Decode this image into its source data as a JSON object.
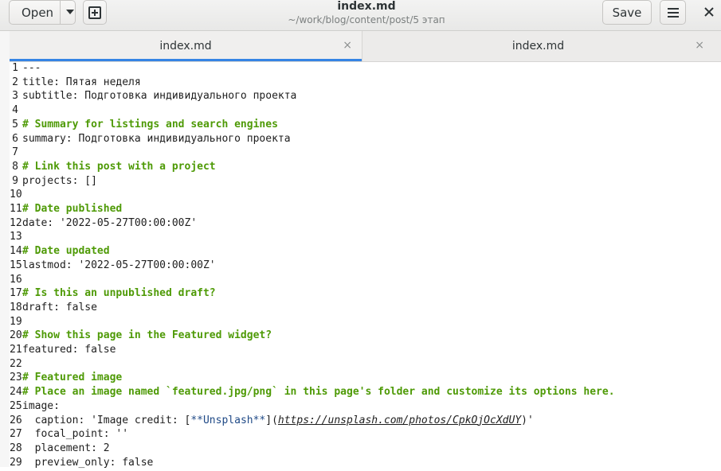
{
  "header": {
    "open_label": "Open",
    "title": "index.md",
    "subtitle": "~/work/blog/content/post/5 этап",
    "save_label": "Save"
  },
  "tabs": [
    {
      "label": "index.md",
      "close": "×"
    },
    {
      "label": "index.md",
      "close": "×"
    }
  ],
  "lines": [
    {
      "n": "1",
      "text": "---"
    },
    {
      "n": "2",
      "text": "title: Пятая неделя"
    },
    {
      "n": "3",
      "text": "subtitle: Подготовка индивидуального проекта"
    },
    {
      "n": "4",
      "text": ""
    },
    {
      "n": "5",
      "text": "# Summary for listings and search engines",
      "comment": true
    },
    {
      "n": "6",
      "text": "summary: Подготовка индивидуального проекта"
    },
    {
      "n": "7",
      "text": ""
    },
    {
      "n": "8",
      "text": "# Link this post with a project",
      "comment": true
    },
    {
      "n": "9",
      "text": "projects: []"
    },
    {
      "n": "10",
      "text": ""
    },
    {
      "n": "11",
      "text": "# Date published",
      "comment": true
    },
    {
      "n": "12",
      "text": "date: '2022-05-27T00:00:00Z'"
    },
    {
      "n": "13",
      "text": ""
    },
    {
      "n": "14",
      "text": "# Date updated",
      "comment": true
    },
    {
      "n": "15",
      "text": "lastmod: '2022-05-27T00:00:00Z'"
    },
    {
      "n": "16",
      "text": ""
    },
    {
      "n": "17",
      "text": "# Is this an unpublished draft?",
      "comment": true
    },
    {
      "n": "18",
      "text": "draft: false"
    },
    {
      "n": "19",
      "text": ""
    },
    {
      "n": "20",
      "text": "# Show this page in the Featured widget?",
      "comment": true
    },
    {
      "n": "21",
      "text": "featured: false"
    },
    {
      "n": "22",
      "text": ""
    },
    {
      "n": "23",
      "text": "# Featured image",
      "comment": true
    },
    {
      "n": "24",
      "text": "# Place an image named `featured.jpg/png` in this page's folder and customize its options here.",
      "comment": true
    },
    {
      "n": "25",
      "text": "image:"
    },
    {
      "n": "26",
      "prefix": "  caption: 'Image credit: [",
      "emph": "**Unsplash**",
      "mid": "](",
      "url": "https://unsplash.com/photos/CpkOjOcXdUY",
      "suffix": ")'"
    },
    {
      "n": "27",
      "text": "  focal_point: ''"
    },
    {
      "n": "28",
      "text": "  placement: 2"
    },
    {
      "n": "29",
      "text": "  preview_only: false"
    }
  ]
}
